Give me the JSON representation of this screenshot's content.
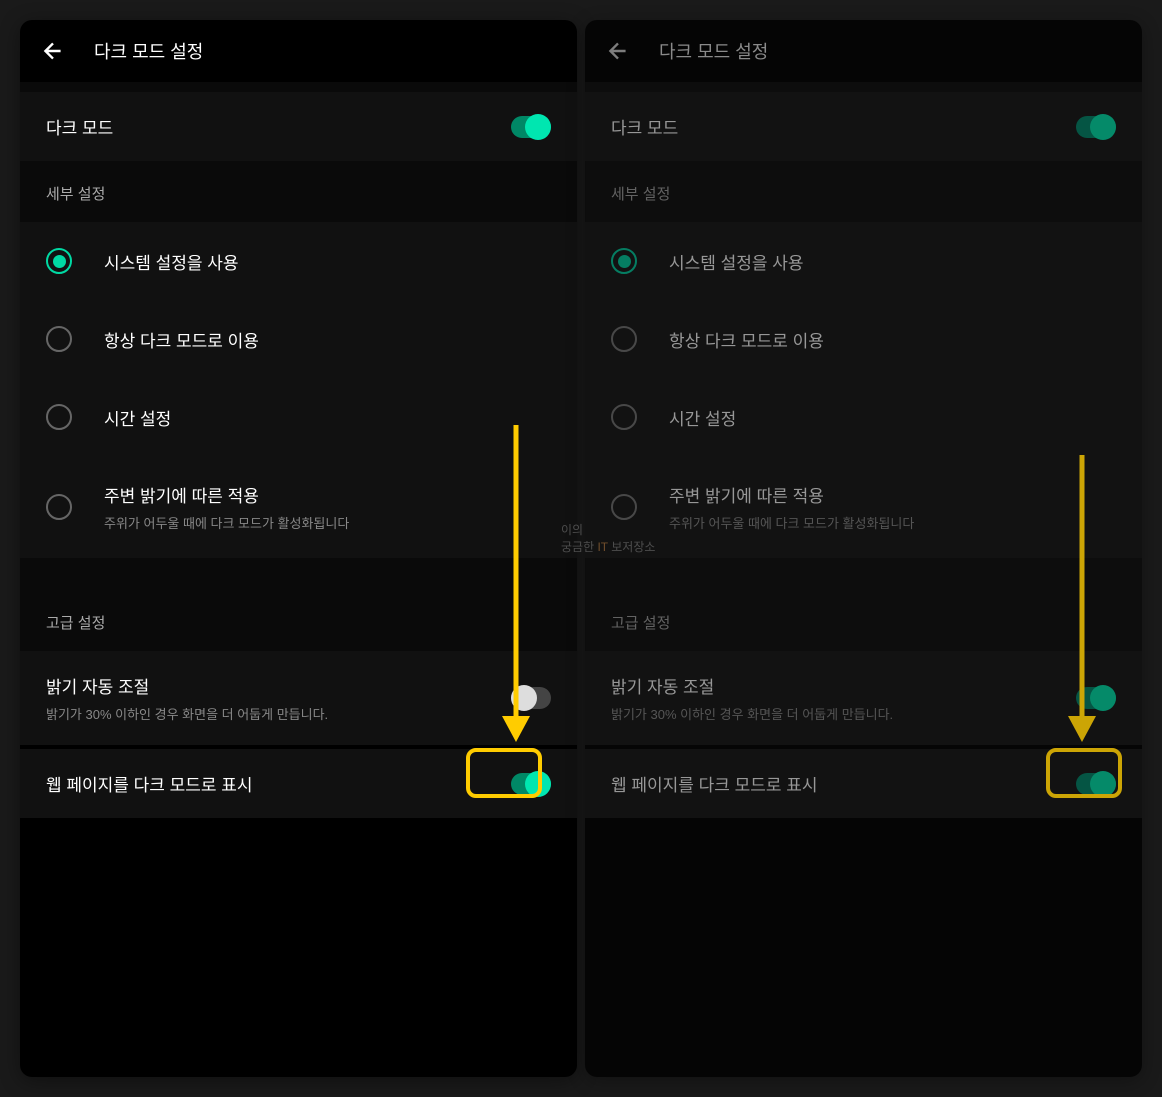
{
  "left": {
    "title": "다크 모드 설정",
    "dark_mode": {
      "label": "다크 모드",
      "value": true
    },
    "detail_section": "세부 설정",
    "radios": [
      {
        "label": "시스템 설정을 사용",
        "selected": true
      },
      {
        "label": "항상 다크 모드로 이용",
        "selected": false
      },
      {
        "label": "시간 설정",
        "selected": false
      },
      {
        "label": "주변 밝기에 따른 적용",
        "sub": "주위가 어두울 때에 다크 모드가 활성화됩니다",
        "selected": false
      }
    ],
    "advanced_section": "고급 설정",
    "brightness_auto": {
      "label": "밝기 자동 조절",
      "sub": "밝기가 30% 이하인 경우 화면을 더 어둡게 만듭니다.",
      "value": false
    },
    "web_dark": {
      "label": "웹 페이지를 다크 모드로 표시",
      "value": true
    }
  },
  "right": {
    "title": "다크 모드 설정",
    "dark_mode": {
      "label": "다크 모드",
      "value": true
    },
    "detail_section": "세부 설정",
    "radios": [
      {
        "label": "시스템 설정을 사용",
        "selected": true
      },
      {
        "label": "항상 다크 모드로 이용",
        "selected": false
      },
      {
        "label": "시간 설정",
        "selected": false
      },
      {
        "label": "주변 밝기에 따른 적용",
        "sub": "주위가 어두울 때에 다크 모드가 활성화됩니다",
        "selected": false
      }
    ],
    "advanced_section": "고급 설정",
    "brightness_auto": {
      "label": "밝기 자동 조절",
      "sub": "밝기가 30% 이하인 경우 화면을 더 어둡게 만듭니다.",
      "value": true
    },
    "web_dark": {
      "label": "웹 페이지를 다크 모드로 표시",
      "value": true
    }
  },
  "watermark_text_1": "이의",
  "watermark_text_2": "궁금한",
  "watermark_text_3": "IT",
  "watermark_text_4": "보저장소",
  "annotation_arrow_color": "#ffcc00",
  "highlight_color": "#ffcc00"
}
